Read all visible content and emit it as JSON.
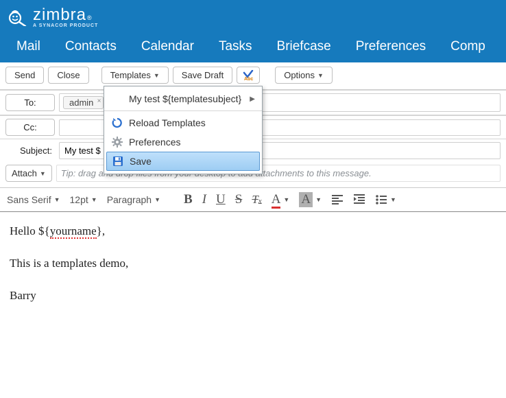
{
  "brand": {
    "name": "zimbra",
    "tagline": "A SYNACOR PRODUCT"
  },
  "nav": {
    "mail": "Mail",
    "contacts": "Contacts",
    "calendar": "Calendar",
    "tasks": "Tasks",
    "briefcase": "Briefcase",
    "preferences": "Preferences",
    "compose": "Comp"
  },
  "toolbar": {
    "send": "Send",
    "close": "Close",
    "templates": "Templates",
    "save_draft": "Save Draft",
    "options": "Options"
  },
  "templates_menu": {
    "my_test": "My test ${templatesubject}",
    "reload": "Reload Templates",
    "prefs": "Preferences",
    "save": "Save"
  },
  "compose": {
    "to_label": "To:",
    "cc_label": "Cc:",
    "subject_label": "Subject:",
    "to_chip": "admin",
    "subject_value": "My test $",
    "attach_label": "Attach",
    "tip": "Tip: drag and drop files from your desktop to add attachments to this message."
  },
  "format": {
    "font": "Sans Serif",
    "size": "12pt",
    "para": "Paragraph"
  },
  "body": {
    "greet_pre": "Hello ${",
    "greet_var": "yourname",
    "greet_post": "},",
    "line2": "This is a templates demo,",
    "sign": "Barry"
  }
}
